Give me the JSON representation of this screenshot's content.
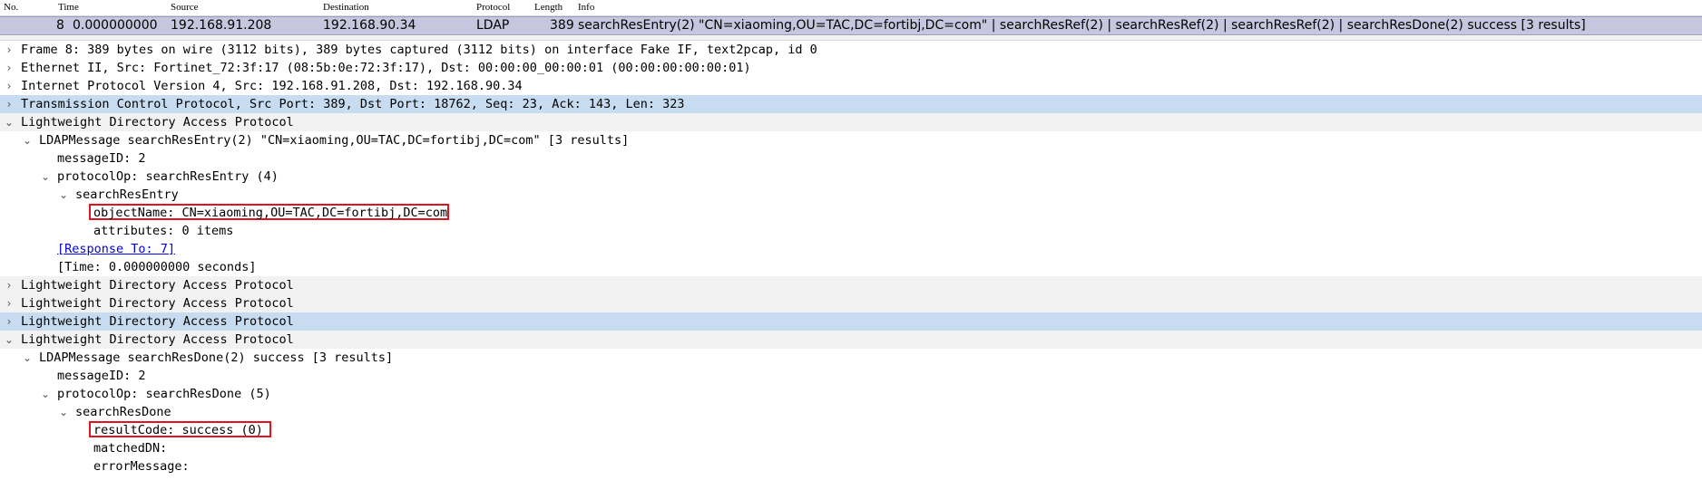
{
  "columns": {
    "no": "No.",
    "time": "Time",
    "source": "Source",
    "destination": "Destination",
    "protocol": "Protocol",
    "length": "Length",
    "info": "Info"
  },
  "packet": {
    "no": "8",
    "time": "0.000000000",
    "source": "192.168.91.208",
    "destination": "192.168.90.34",
    "protocol": "LDAP",
    "length": "389",
    "info": "searchResEntry(2) \"CN=xiaoming,OU=TAC,DC=fortibj,DC=com\"  | searchResRef(2)  | searchResRef(2)  | searchResRef(2)  | searchResDone(2) success  [3 results]"
  },
  "tree": {
    "frame": "Frame 8: 389 bytes on wire (3112 bits), 389 bytes captured (3112 bits) on interface Fake IF, text2pcap, id 0",
    "ethernet": "Ethernet II, Src: Fortinet_72:3f:17 (08:5b:0e:72:3f:17), Dst: 00:00:00_00:00:01 (00:00:00:00:00:01)",
    "ip": "Internet Protocol Version 4, Src: 192.168.91.208, Dst: 192.168.90.34",
    "tcp": "Transmission Control Protocol, Src Port: 389, Dst Port: 18762, Seq: 23, Ack: 143, Len: 323",
    "ldap1": "Lightweight Directory Access Protocol",
    "ldap1_msg": "LDAPMessage searchResEntry(2) \"CN=xiaoming,OU=TAC,DC=fortibj,DC=com\" [3 results]",
    "ldap1_msgid": "messageID: 2",
    "ldap1_op": "protocolOp: searchResEntry (4)",
    "ldap1_entry": "searchResEntry",
    "ldap1_objname": "objectName: CN=xiaoming,OU=TAC,DC=fortibj,DC=com",
    "ldap1_attrs": "attributes: 0 items",
    "ldap1_resp": "[Response To: 7]",
    "ldap1_time": "[Time: 0.000000000 seconds]",
    "ldap2": "Lightweight Directory Access Protocol",
    "ldap3": "Lightweight Directory Access Protocol",
    "ldap4": "Lightweight Directory Access Protocol",
    "ldap5": "Lightweight Directory Access Protocol",
    "ldap5_msg": "LDAPMessage searchResDone(2) success [3 results]",
    "ldap5_msgid": "messageID: 2",
    "ldap5_op": "protocolOp: searchResDone (5)",
    "ldap5_done": "searchResDone",
    "ldap5_result": "resultCode: success (0)",
    "ldap5_matched": "matchedDN:",
    "ldap5_err": "errorMessage:"
  },
  "icons": {
    "collapsed": "chevron-right-icon",
    "expanded": "chevron-down-icon"
  },
  "colors": {
    "selected_packet": "#c6c6df",
    "selected_tree": "#c7dcf0",
    "highlight_box": "#e0141e",
    "link": "#0000ee"
  }
}
